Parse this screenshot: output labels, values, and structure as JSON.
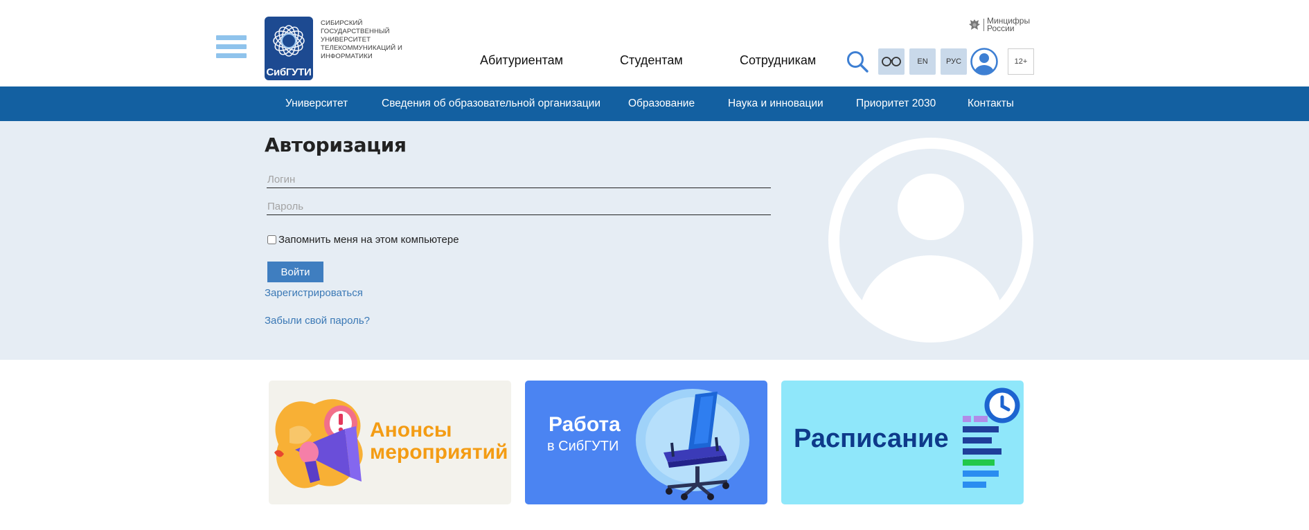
{
  "header": {
    "logo_text": "СибГУТИ",
    "university_name": "Сибирский государственный университет телекоммуникаций и информатики",
    "ministry": {
      "line1": "Минцифры",
      "line2": "России"
    },
    "top_nav": [
      "Абитуриентам",
      "Студентам",
      "Сотрудникам"
    ],
    "lang_en": "EN",
    "lang_ru": "РУС",
    "age_rating": "12+"
  },
  "main_nav": [
    "Университет",
    "Сведения об образовательной организации",
    "Образование",
    "Наука и инновации",
    "Приоритет 2030",
    "Контакты"
  ],
  "auth": {
    "title": "Авторизация",
    "login_placeholder": "Логин",
    "password_placeholder": "Пароль",
    "remember_label": "Запомнить меня на этом компьютере",
    "submit_label": "Войти",
    "register_link": "Зарегистрироваться",
    "forgot_link": "Забыли свой пароль?"
  },
  "banners": [
    {
      "line1": "Анонсы",
      "line2": "мероприятий",
      "bg": "#f3f2ec",
      "color": "#f39c14"
    },
    {
      "line1": "Работа",
      "line2": "в СибГУТИ",
      "bg": "#4b84f2",
      "color": "#ffffff"
    },
    {
      "line1": "Расписание",
      "bg": "#8fe7fa",
      "color": "#0e3a8a"
    }
  ],
  "colors": {
    "nav_bar": "#1360a1",
    "auth_bg": "#e6edf4",
    "button": "#3f7ec0",
    "link": "#3a78b5",
    "logo": "#1d4a91"
  }
}
